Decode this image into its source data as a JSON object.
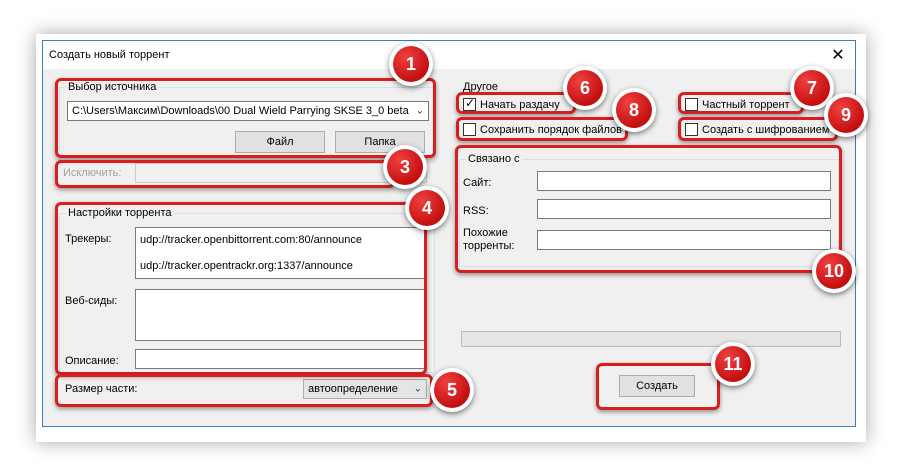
{
  "window": {
    "title": "Создать новый торрент",
    "close_glyph": "✕"
  },
  "source": {
    "group_title": "Выбор источника",
    "path": "C:\\Users\\Максим\\Downloads\\00 Dual Wield Parrying SKSE 3_0 beta",
    "file_button": "Файл",
    "folder_button": "Папка"
  },
  "exclude": {
    "label": "Исключить:"
  },
  "settings": {
    "group_title": "Настройки торрента",
    "trackers_label": "Трекеры:",
    "trackers": [
      "udp://tracker.openbittorrent.com:80/announce",
      "udp://tracker.opentrackr.org:1337/announce"
    ],
    "webseeds_label": "Веб-сиды:",
    "description_label": "Описание:"
  },
  "piece_size": {
    "label": "Размер части:",
    "value": "автоопределение"
  },
  "other": {
    "group_title": "Другое",
    "start_seeding": {
      "label": "Начать раздачу",
      "checked": true
    },
    "private_torrent": {
      "label": "Частный торрент",
      "checked": false
    },
    "preserve_order": {
      "label": "Сохранить порядок файлов",
      "checked": false
    },
    "encryption": {
      "label": "Создать с шифрованием",
      "checked": false
    }
  },
  "related": {
    "group_title": "Связано с",
    "site_label": "Сайт:",
    "rss_label": "RSS:",
    "similar_label_1": "Похожие",
    "similar_label_2": "торренты:"
  },
  "create_button": "Создать",
  "progress": 0,
  "markers": [
    "1",
    "2",
    "3",
    "4",
    "5",
    "6",
    "7",
    "8",
    "9",
    "10",
    "11"
  ],
  "colors": {
    "annotation_red": "#d91e1e",
    "window_border": "#3c7fb1",
    "dialog_bg": "#f0f0f0"
  },
  "icons": {
    "close": "close-icon",
    "dropdown": "chevron-down-icon",
    "checkmark": "checkmark-icon"
  }
}
